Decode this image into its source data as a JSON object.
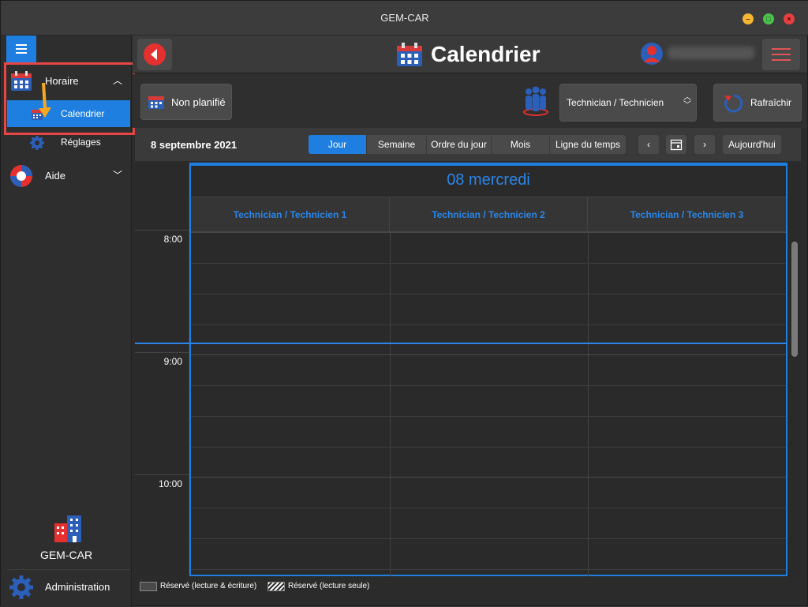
{
  "window": {
    "title": "GEM-CAR"
  },
  "sidebar": {
    "items": [
      {
        "label": "Horaire"
      },
      {
        "label": "Calendrier"
      },
      {
        "label": "Réglages"
      },
      {
        "label": "Aide"
      }
    ],
    "brand": "GEM-CAR",
    "admin": "Administration"
  },
  "header": {
    "title": "Calendrier"
  },
  "toolbar": {
    "unplanned": "Non planifié",
    "technician_select": "Technician / Technicien",
    "refresh": "Rafraîchir"
  },
  "calnav": {
    "date": "8 septembre 2021",
    "tabs": [
      "Jour",
      "Semaine",
      "Ordre du jour",
      "Mois",
      "Ligne du temps"
    ],
    "active_tab": "Jour",
    "prev": "‹",
    "next": "›",
    "today": "Aujourd'hui"
  },
  "calendar": {
    "day_title": "08 mercredi",
    "technicians": [
      "Technician / Technicien 1",
      "Technician / Technicien 2",
      "Technician / Technicien 3"
    ],
    "hours": [
      "8:00",
      "9:00",
      "10:00"
    ]
  },
  "legend": {
    "rw": "Réservé (lecture & écriture)",
    "ro": "Réservé (lecture seule)"
  },
  "colors": {
    "accent": "#1e7fe0",
    "danger": "#e53030"
  }
}
